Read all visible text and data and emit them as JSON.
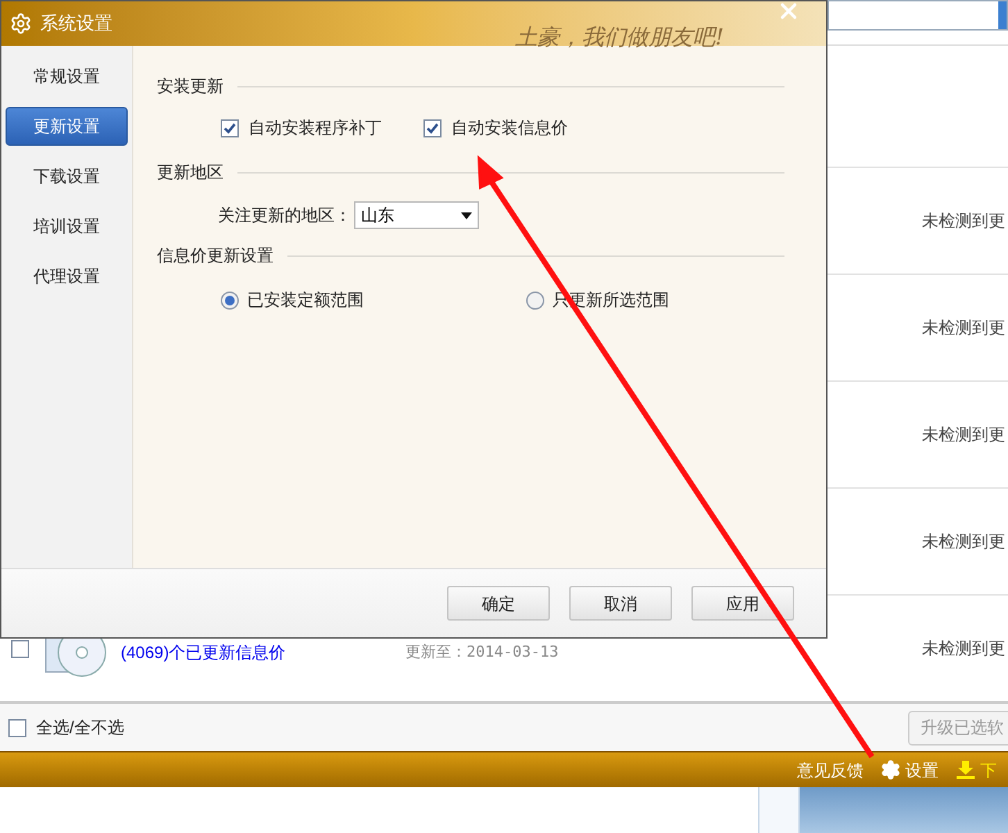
{
  "app": {
    "rows": [
      {
        "status": "未检测到更"
      },
      {
        "status": "未检测到更"
      },
      {
        "status": "未检测到更"
      },
      {
        "status": "未检测到更"
      },
      {
        "checked": false,
        "name": "(4069)个已更新信息价",
        "date": "更新至：2014-03-13",
        "status": "未检测到更"
      }
    ],
    "select_all": {
      "label": "全选/全不选",
      "checked": false
    },
    "upgrade_button": "升级已选软",
    "bottom_bar": {
      "links": [
        {
          "kind": "plain",
          "label": "意见反馈"
        },
        {
          "kind": "gear",
          "label": "设置"
        },
        {
          "kind": "download",
          "label": "下"
        }
      ]
    }
  },
  "dialog": {
    "title": "系统设置",
    "banner_slogan": "土豪，我们做朋友吧!",
    "sidebar": [
      {
        "label": "常规设置",
        "selected": false
      },
      {
        "label": "更新设置",
        "selected": true
      },
      {
        "label": "下载设置",
        "selected": false
      },
      {
        "label": "培训设置",
        "selected": false
      },
      {
        "label": "代理设置",
        "selected": false
      }
    ],
    "sections": [
      {
        "kind": "checkboxes",
        "title": "安装更新",
        "options": [
          {
            "label": "自动安装程序补丁",
            "checked": true
          },
          {
            "label": "自动安装信息价",
            "checked": true
          }
        ]
      },
      {
        "kind": "select",
        "title": "更新地区",
        "label": "关注更新的地区：",
        "value": "山东"
      },
      {
        "kind": "radios",
        "title": "信息价更新设置",
        "options": [
          {
            "label": "已安装定额范围",
            "selected": true
          },
          {
            "label": "只更新所选范围",
            "selected": false
          }
        ]
      }
    ],
    "buttons": [
      "确定",
      "取消",
      "应用"
    ]
  }
}
